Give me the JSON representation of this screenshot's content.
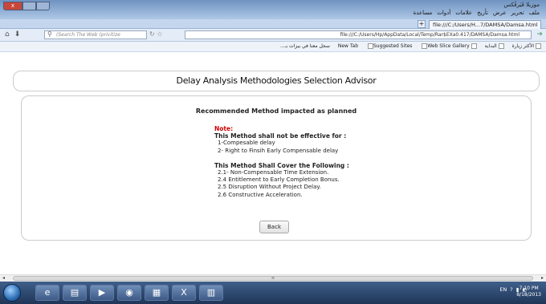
{
  "window": {
    "app_title": "موزيلا فَيَرفُكس",
    "menu": [
      "ملف",
      "تحرير",
      "عرض",
      "تأريخ",
      "علامات",
      "أدوات",
      "مساعدة"
    ],
    "controls": {
      "close": "x",
      "max": "",
      "min": ""
    }
  },
  "tab": {
    "title": "file:///C:/Users/H...7/DAMSA/Damsa.html",
    "new_tab": "+"
  },
  "nav": {
    "search_placeholder": "(Search The Web (privitize",
    "url": "file:///C:/Users/Hp/AppData/Local/Temp/Rar$EXa0.417/DAMSA/Damsa.html"
  },
  "favorites": [
    "الأكثر زيارة",
    "البداية",
    "New Tab",
    "Suggested Sites",
    "Web Slice Gallery",
    "سجل معنا في بيزات بـ..."
  ],
  "page": {
    "title": "Delay Analysis Methodologies Selection Advisor",
    "heading": "Recommended Method impacted as planned",
    "note_label": "Note:",
    "not_effective_heading": "This Method shall not be effective for :",
    "not_effective_items": [
      "1-Compesable delay",
      "2- Right to Finsih Early Compensable delay"
    ],
    "cover_heading": "This Method Shall Cover the Following :",
    "cover_items": [
      "2.1- Non-Compensable Time Extension.",
      "2.4 Entitlement to Early Completion Bonus.",
      "2.5 Disruption Without Project Delay.",
      "2.6 Constructive Acceleration."
    ],
    "back_label": "Back"
  },
  "scrollbar": {
    "grip": "≡"
  },
  "taskbar": {
    "lang": "EN",
    "time": "7:10 PM",
    "date": "8/18/2013"
  },
  "colors": {
    "note": "#d40000",
    "titlebar": "#6f93c1",
    "taskbar": "#1f3557"
  }
}
